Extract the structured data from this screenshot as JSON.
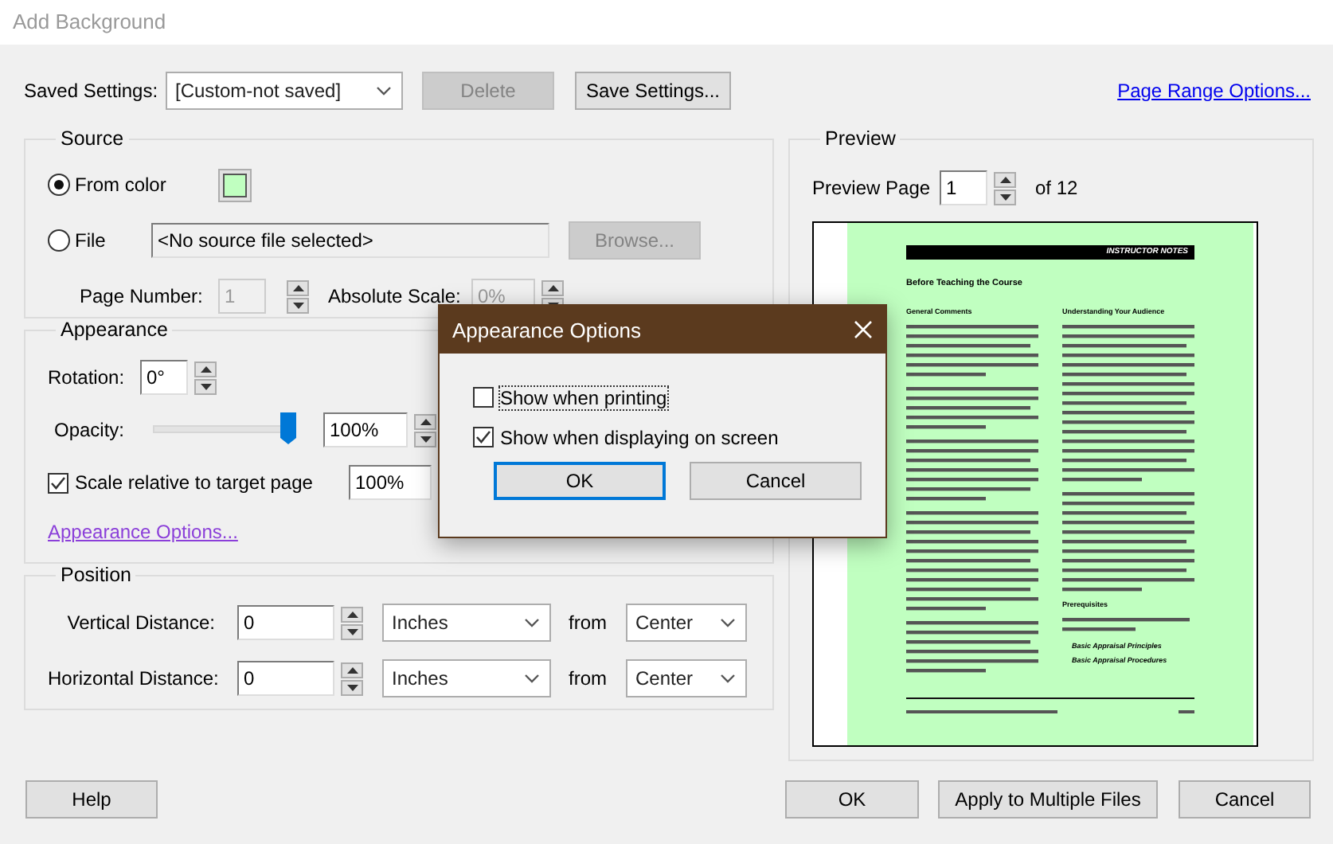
{
  "window": {
    "title": "Add Background"
  },
  "saved_settings": {
    "label": "Saved Settings:",
    "value": "[Custom-not saved]",
    "delete_button": {
      "label": "Delete",
      "disabled": true
    },
    "save_button": {
      "label": "Save Settings...",
      "disabled": false
    }
  },
  "page_range_link": "Page Range Options...",
  "source": {
    "title": "Source",
    "color": "#c0ffc0",
    "options": [
      {
        "kind": "color",
        "label": "From color",
        "selected": true
      },
      {
        "kind": "file",
        "label": "File",
        "selected": false
      }
    ],
    "file_value": "<No source file selected>",
    "browse_button": {
      "label": "Browse...",
      "disabled": true
    },
    "page_number": {
      "label": "Page Number:",
      "value": "1",
      "disabled": true
    },
    "absolute_scale": {
      "label": "Absolute Scale:",
      "value": "0%",
      "disabled": true
    }
  },
  "appearance": {
    "title": "Appearance",
    "rotation": {
      "label": "Rotation:",
      "value": "0°"
    },
    "opacity": {
      "label": "Opacity:",
      "level": 1,
      "value": "100%"
    },
    "scale_relative": {
      "label": "Scale relative to target page",
      "checked": true,
      "value": "100%"
    },
    "options_link": "Appearance Options..."
  },
  "position": {
    "title": "Position",
    "rows": [
      {
        "label": "Vertical Distance:",
        "value": "0",
        "unit": "Inches",
        "from_label": "from",
        "anchor": "Center"
      },
      {
        "label": "Horizontal Distance:",
        "value": "0",
        "unit": "Inches",
        "from_label": "from",
        "anchor": "Center"
      }
    ]
  },
  "preview": {
    "title": "Preview",
    "page_label": "Preview Page",
    "page": "1",
    "of_label": "of 12",
    "document": {
      "banner": "INSTRUCTOR NOTES",
      "heading": "Before Teaching the Course",
      "columns": [
        {
          "heading": "General Comments"
        },
        {
          "heading": "Understanding Your Audience",
          "subheading": "Prerequisites",
          "bullets": [
            "Basic Appraisal Principles",
            "Basic Appraisal Procedures"
          ]
        }
      ]
    }
  },
  "buttons": [
    {
      "label": "Help"
    },
    {
      "label": "OK"
    },
    {
      "label": "Apply to Multiple Files"
    },
    {
      "label": "Cancel"
    }
  ],
  "modal": {
    "title": "Appearance Options",
    "options": [
      {
        "label": "Show when printing",
        "checked": false,
        "focused": true
      },
      {
        "label": "Show when displaying on screen",
        "checked": true,
        "focused": false
      }
    ],
    "buttons": [
      {
        "label": "OK",
        "default": true
      },
      {
        "label": "Cancel",
        "default": false
      }
    ]
  }
}
